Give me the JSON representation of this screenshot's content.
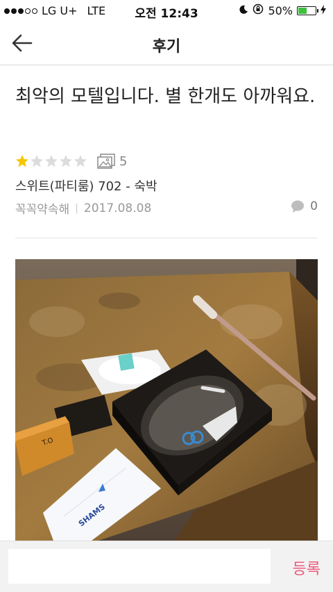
{
  "status_bar": {
    "carrier": "LG U+",
    "network": "LTE",
    "time": "오전 12:43",
    "battery": "50%",
    "battery_level": 0.5,
    "signal_strength": 3
  },
  "nav": {
    "title": "후기"
  },
  "review": {
    "title": "최악의 모텔입니다. 별 한개도 아까워요.",
    "rating": 1,
    "max_rating": 5,
    "photo_count": "5",
    "room": "스위트(파티룸) 702 - 숙박",
    "author": "꼭꼭약속해",
    "separator": "|",
    "date": "2017.08.08",
    "comment_count": "0"
  },
  "comment_bar": {
    "placeholder": "",
    "submit_label": "등록"
  },
  "colors": {
    "star_filled": "#f7c600",
    "star_empty": "#dcdcdc",
    "submit": "#ee5a7f",
    "battery_fill": "#3ec03e"
  }
}
